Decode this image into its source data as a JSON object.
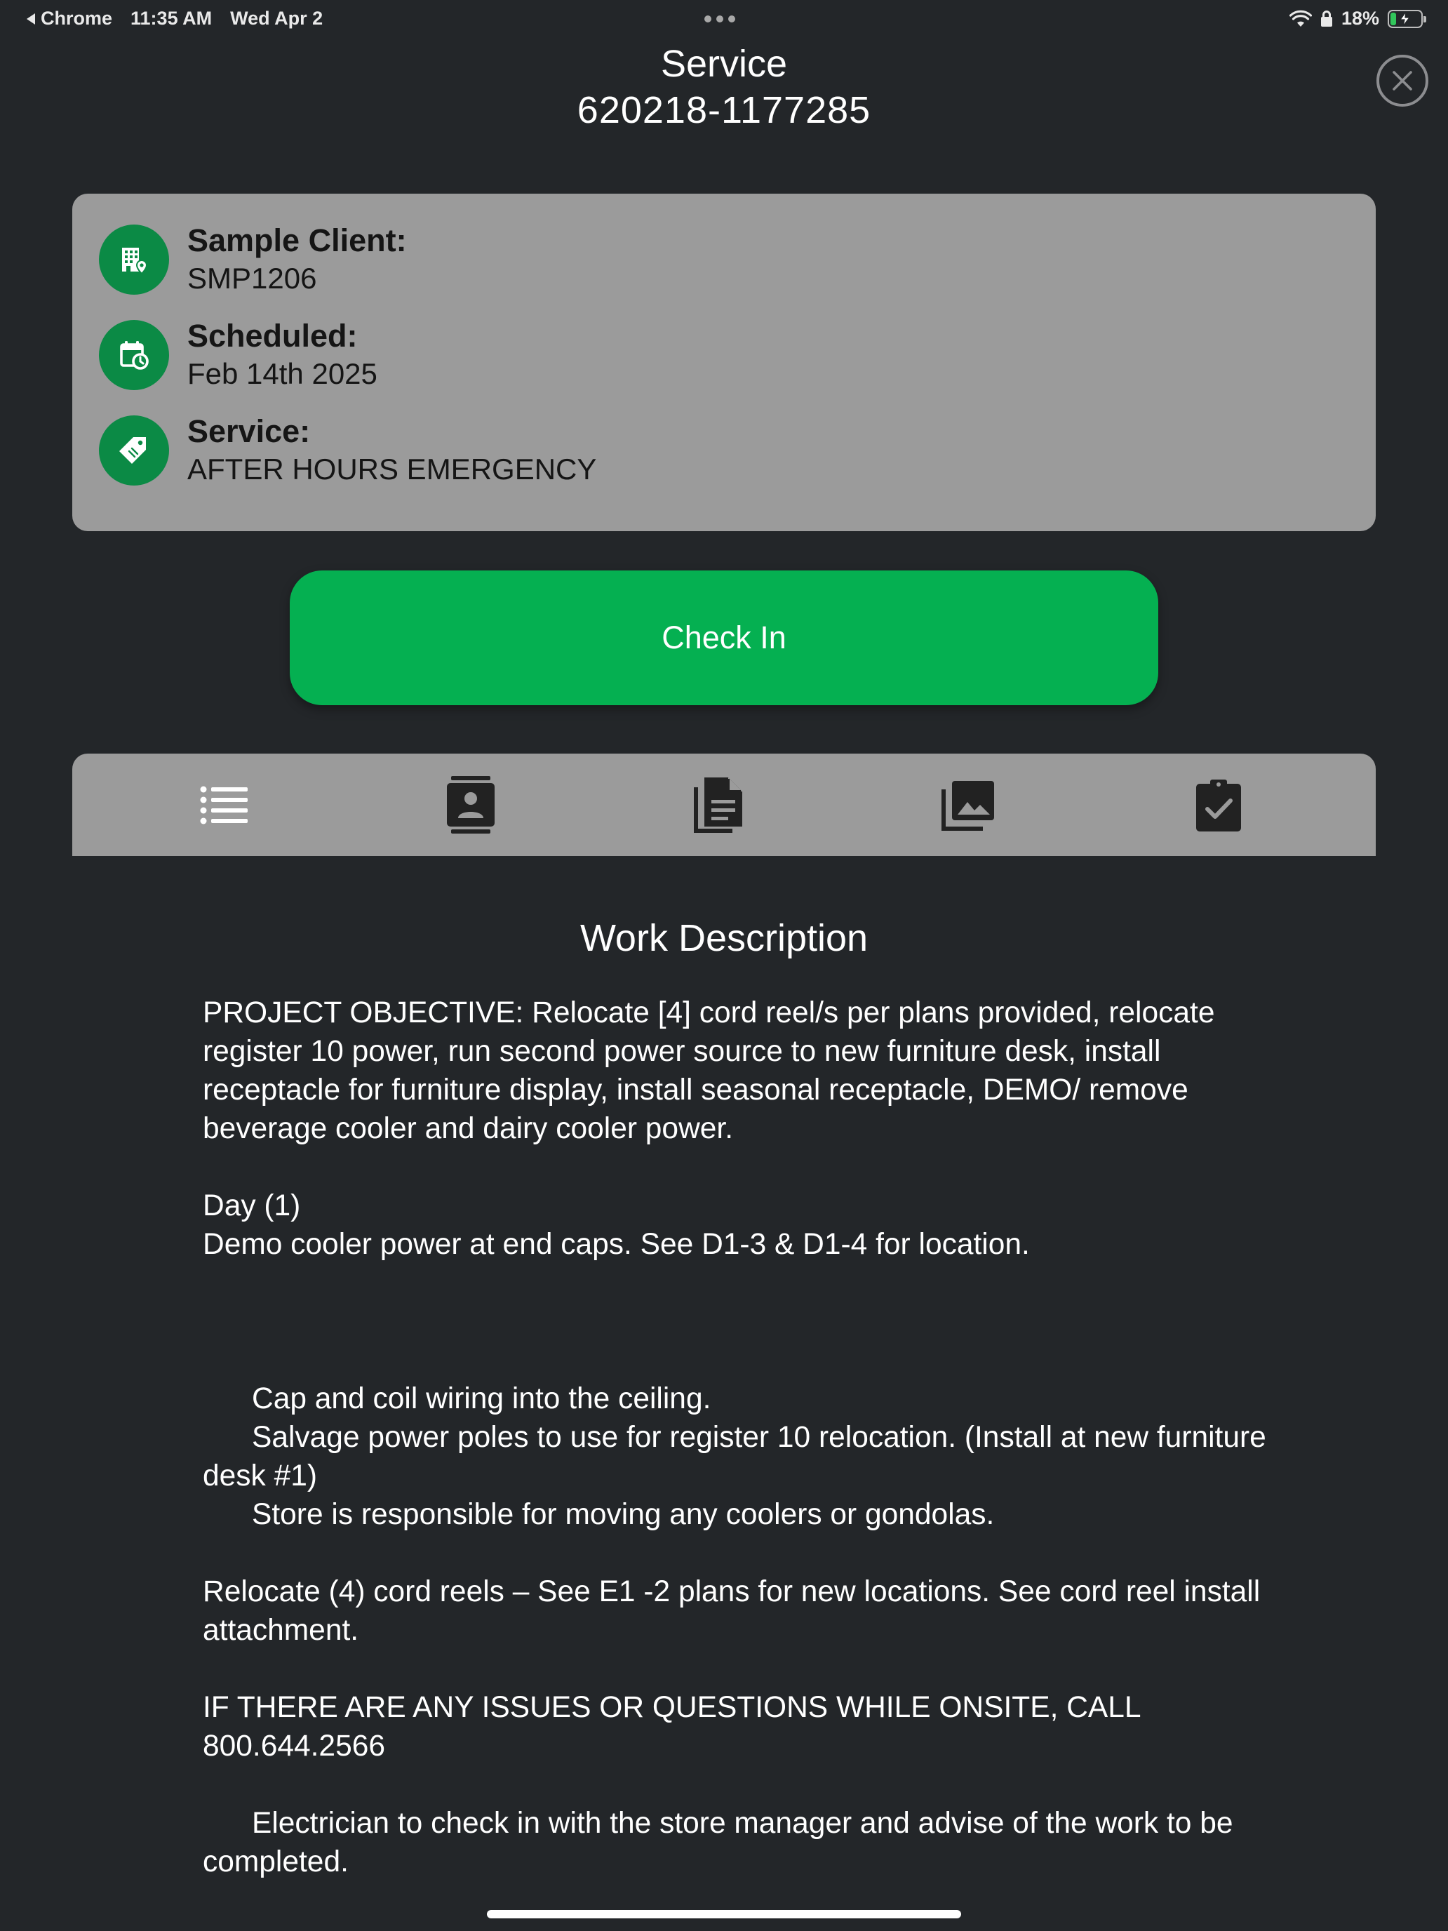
{
  "status_bar": {
    "back_app": "Chrome",
    "time": "11:35 AM",
    "date": "Wed Apr 2",
    "battery_percent": "18%",
    "battery_level": 0.18,
    "charging": true
  },
  "header": {
    "title_line1": "Service",
    "title_line2": "620218-1177285",
    "close_icon": "close-circle-icon"
  },
  "info_card": {
    "client": {
      "label": "Sample Client:",
      "value": "SMP1206",
      "icon": "building-location-icon"
    },
    "scheduled": {
      "label": "Scheduled:",
      "value": "Feb 14th 2025",
      "icon": "calendar-clock-icon"
    },
    "service": {
      "label": "Service:",
      "value": "AFTER HOURS EMERGENCY",
      "icon": "tag-icon"
    },
    "icon_bg_color": "#0b8a45"
  },
  "checkin_button": {
    "label": "Check In",
    "color": "#05b051"
  },
  "tabs": [
    {
      "icon": "list-icon",
      "active": true
    },
    {
      "icon": "contact-card-icon",
      "active": false
    },
    {
      "icon": "documents-icon",
      "active": false
    },
    {
      "icon": "photo-gallery-icon",
      "active": false
    },
    {
      "icon": "clipboard-check-icon",
      "active": false
    }
  ],
  "work_description": {
    "title": "Work Description",
    "objective": "PROJECT OBJECTIVE: Relocate [4] cord reel/s per plans provided, relocate register 10 power, run second power source to new furniture desk, install receptacle for furniture display, install seasonal receptacle, DEMO/ remove beverage cooler and dairy cooler power.",
    "day_label": "Day (1)",
    "day_item": "Demo cooler power at end caps. See D1-3 & D1-4 for location.",
    "step1": "Cap and coil wiring into the ceiling.",
    "step2": "Salvage power poles to use for register 10 relocation. (Install at new furniture desk #1)",
    "step3": "Store is responsible for moving any coolers or gondolas.",
    "relocate": "Relocate (4) cord reels – See E1 -2 plans for new locations. See cord reel install attachment.",
    "issues": "IF THERE ARE ANY ISSUES OR QUESTIONS WHILE ONSITE, CALL 800.644.2566",
    "electrician": "Electrician to check in with the store manager and advise of the work to be completed."
  }
}
